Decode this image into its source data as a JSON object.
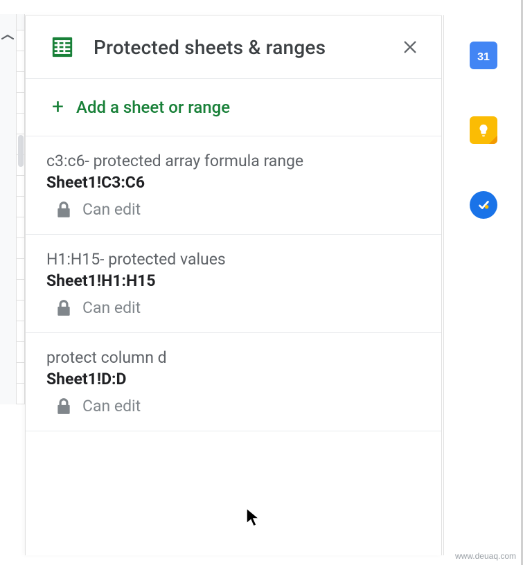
{
  "panel": {
    "title": "Protected sheets & ranges",
    "add_label": "Add a sheet or range"
  },
  "ranges": [
    {
      "description": "c3:c6- protected array formula range",
      "reference": "Sheet1!C3:C6",
      "permission": "Can edit"
    },
    {
      "description": "H1:H15- protected values",
      "reference": "Sheet1!H1:H15",
      "permission": "Can edit"
    },
    {
      "description": "protect column d",
      "reference": "Sheet1!D:D",
      "permission": "Can edit"
    }
  ],
  "sidebar": {
    "calendar_day": "31"
  },
  "watermark": "www.deuaq.com"
}
